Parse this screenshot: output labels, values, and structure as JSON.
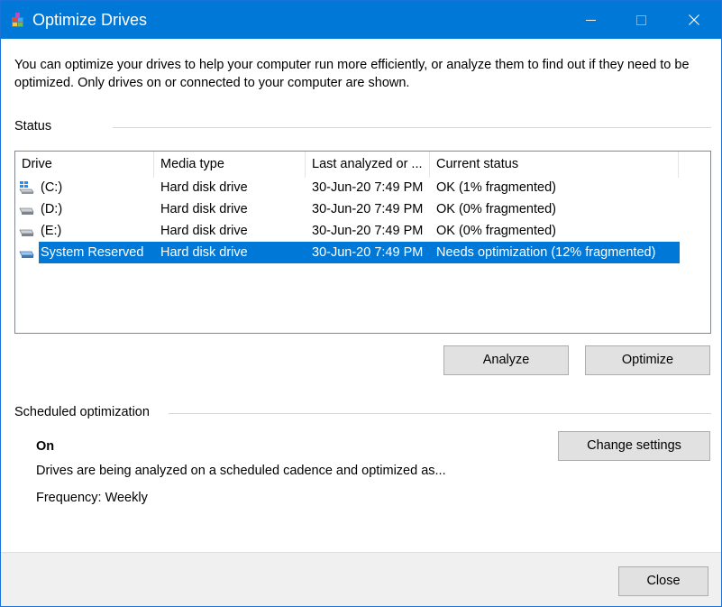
{
  "window": {
    "title": "Optimize Drives",
    "icon": "defrag-app-icon",
    "titlebar_color": "#0078d7"
  },
  "intro_text": "You can optimize your drives to help your computer run more efficiently, or analyze them to find out if they need to be optimized. Only drives on or connected to your computer are shown.",
  "status": {
    "label": "Status",
    "columns": [
      "Drive",
      "Media type",
      "Last analyzed or ...",
      "Current status"
    ],
    "rows": [
      {
        "drive": "(C:)",
        "icon": "windows-drive-icon",
        "media": "Hard disk drive",
        "last": "30-Jun-20 7:49 PM",
        "status": "OK (1% fragmented)",
        "selected": false
      },
      {
        "drive": "(D:)",
        "icon": "hard-drive-icon",
        "media": "Hard disk drive",
        "last": "30-Jun-20 7:49 PM",
        "status": "OK (0% fragmented)",
        "selected": false
      },
      {
        "drive": "(E:)",
        "icon": "hard-drive-icon",
        "media": "Hard disk drive",
        "last": "30-Jun-20 7:49 PM",
        "status": "OK (0% fragmented)",
        "selected": false
      },
      {
        "drive": "System Reserved",
        "icon": "hard-drive-icon",
        "media": "Hard disk drive",
        "last": "30-Jun-20 7:49 PM",
        "status": "Needs optimization (12% fragmented)",
        "selected": true
      }
    ],
    "selection_color": "#0078d7"
  },
  "buttons": {
    "analyze": "Analyze",
    "optimize": "Optimize",
    "change_settings": "Change settings",
    "close": "Close"
  },
  "scheduled": {
    "label": "Scheduled optimization",
    "state": "On",
    "description": "Drives are being analyzed on a scheduled cadence and optimized as...",
    "frequency": "Frequency: Weekly"
  }
}
